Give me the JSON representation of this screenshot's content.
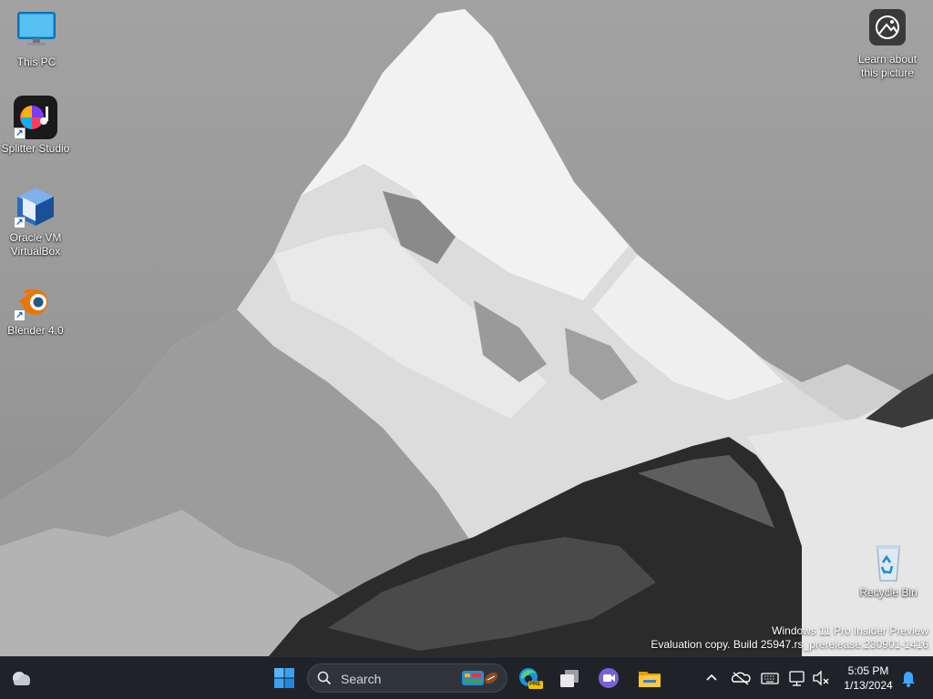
{
  "desktop": {
    "icons": [
      {
        "id": "this-pc",
        "label": "This PC",
        "icon": "monitor-icon"
      },
      {
        "id": "splitter",
        "label": "Splitter Studio",
        "icon": "splitter-studio-icon"
      },
      {
        "id": "virtualbox",
        "label": "Oracle VM VirtualBox",
        "icon": "virtualbox-icon"
      },
      {
        "id": "blender",
        "label": "Blender 4.0",
        "icon": "blender-icon"
      },
      {
        "id": "learn",
        "label": "Learn about this picture",
        "icon": "camera-icon"
      },
      {
        "id": "recycle",
        "label": "Recycle Bin",
        "icon": "recycle-bin-icon"
      }
    ],
    "watermark": {
      "line1": "Windows 11 Pro Insider Preview",
      "line2": "Evaluation copy. Build 25947.rs_prerelease.230901-1416"
    }
  },
  "taskbar": {
    "search_label": "Search",
    "apps": [
      "start-icon",
      "edge-icon",
      "task-view-icon",
      "teams-icon",
      "file-explorer-icon"
    ],
    "edge_badge": "PRE",
    "clock": {
      "time": "5:05 PM",
      "date": "1/13/2024"
    },
    "tray_icons": [
      "chevron-up-icon",
      "onedrive-icon",
      "keyboard-icon",
      "network-icon",
      "volume-muted-icon",
      "notification-icon"
    ]
  },
  "colors": {
    "taskbar_bg": "#1f2328",
    "accent": "#0078d4"
  }
}
